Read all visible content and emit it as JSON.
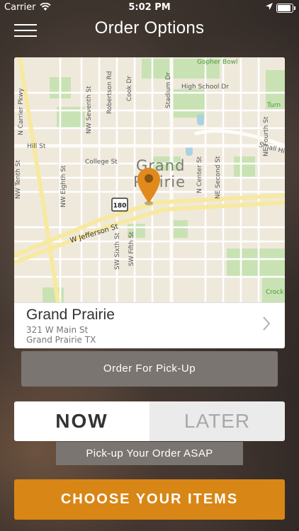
{
  "status_bar": {
    "carrier": "Carrier",
    "time": "5:02 PM"
  },
  "header": {
    "title": "Order Options"
  },
  "map": {
    "city_label_line1": "Grand",
    "city_label_line2": "Prairie",
    "streets": {
      "gopher_bowl": "Gopher Bowl",
      "high_school": "High School Dr",
      "hill_st": "Hill St",
      "college_st": "College St",
      "small_hill": "Small Hi",
      "jefferson": "W Jefferson St",
      "carrier_pkwy": "N Carrier Pkwy",
      "robertson": "Robertson Rd",
      "cook_dr": "Cook Dr",
      "stadium_dr": "Stadium Dr",
      "nw_seventh": "NW Seventh St",
      "nw_tenth": "NW Tenth St",
      "nw_eighth": "NW Eighth St",
      "ne_fourth": "NE Fourth St",
      "n_center": "N Center St",
      "ne_second": "NE Second St",
      "sw_sixth": "SW Sixth St",
      "sw_fifth": "SW Fifth St",
      "turn": "Turn",
      "crock": "Crock",
      "hwy": "180"
    },
    "pin_color": "#e08a1e"
  },
  "store": {
    "name": "Grand Prairie",
    "address_line1": "321 W Main St",
    "address_line2": "Grand Prairie TX"
  },
  "order_type": {
    "label": "Order For Pick-Up"
  },
  "timing": {
    "now_label": "NOW",
    "later_label": "LATER",
    "selected": "NOW",
    "caption": "Pick-up Your Order ASAP"
  },
  "cta": {
    "label": "CHOOSE YOUR ITEMS",
    "color": "#d88616"
  }
}
